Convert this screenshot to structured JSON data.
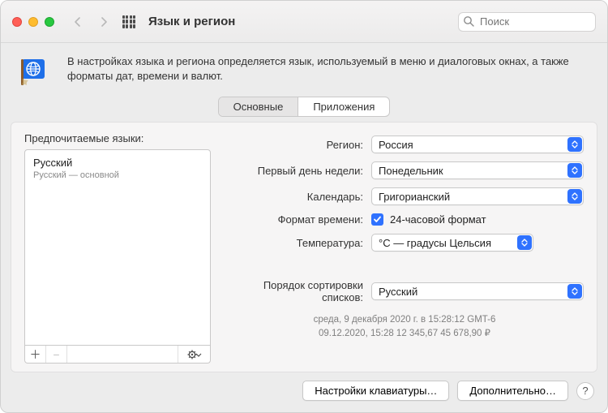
{
  "window": {
    "title": "Язык и регион"
  },
  "search": {
    "placeholder": "Поиск"
  },
  "description": "В настройках языка и региона определяется язык, используемый в меню и диалоговых окнах, а также форматы дат, времени и валют.",
  "tabs": [
    {
      "label": "Основные",
      "active": true
    },
    {
      "label": "Приложения",
      "active": false
    }
  ],
  "left": {
    "heading": "Предпочитаемые языки:",
    "primary_language": "Русский",
    "primary_subtitle": "Русский — основной"
  },
  "form": {
    "region_label": "Регион:",
    "region_value": "Россия",
    "first_weekday_label": "Первый день недели:",
    "first_weekday_value": "Понедельник",
    "calendar_label": "Календарь:",
    "calendar_value": "Григорианский",
    "time_format_label": "Формат времени:",
    "time_format_check": "24-часовой формат",
    "temperature_label": "Температура:",
    "temperature_value": "°C — градусы Цельсия",
    "sort_label": "Порядок сортировки списков:",
    "sort_value": "Русский"
  },
  "sample": {
    "line1": "среда, 9 декабря 2020 г. в 15:28:12 GMT-6",
    "line2": "09.12.2020, 15:28    12 345,67    45 678,90 ₽"
  },
  "footer": {
    "keyboard": "Настройки клавиатуры…",
    "advanced": "Дополнительно…"
  }
}
